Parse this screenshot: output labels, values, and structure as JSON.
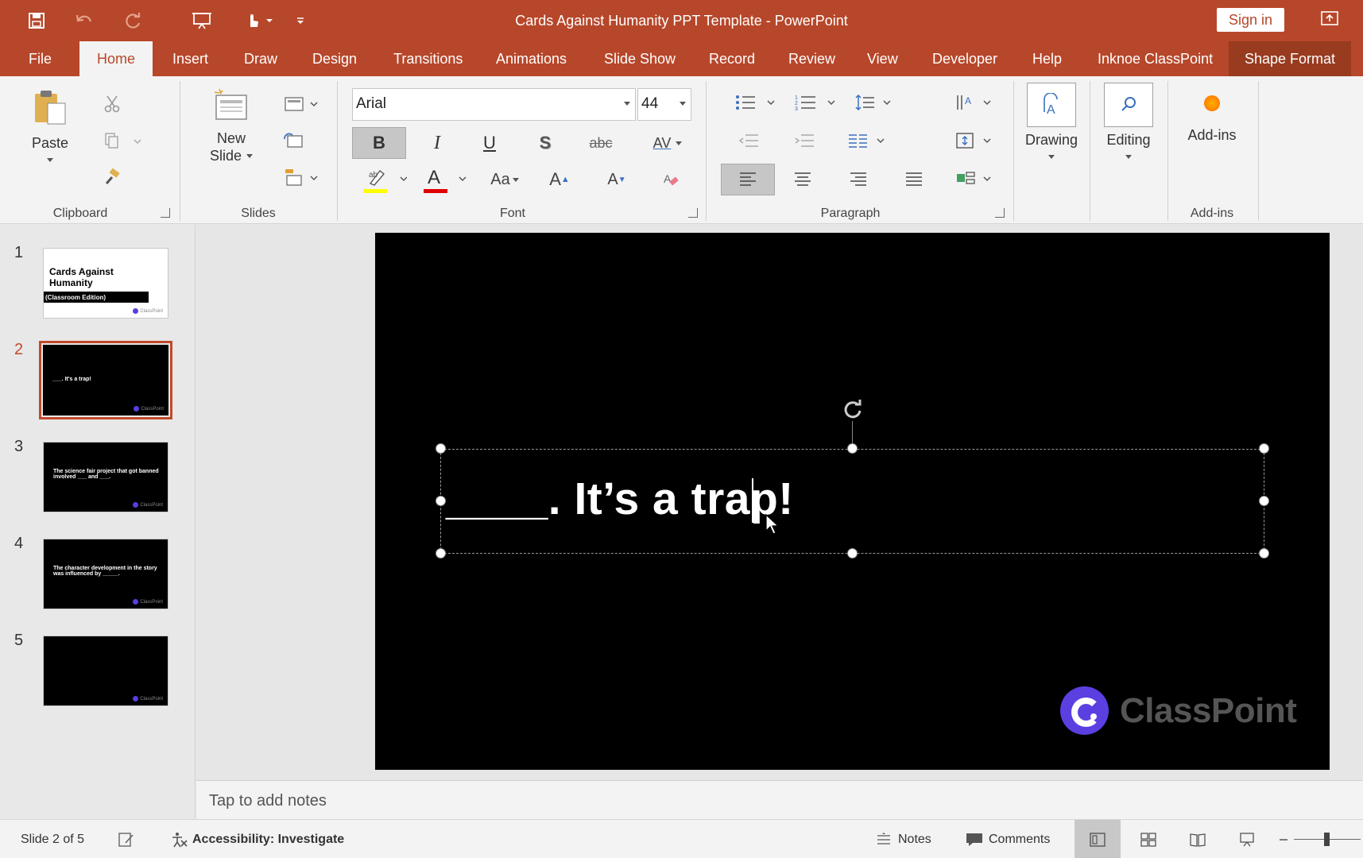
{
  "window": {
    "title": "Cards Against Humanity PPT Template  -  PowerPoint",
    "sign_in": "Sign in"
  },
  "tabs": [
    "File",
    "Home",
    "Insert",
    "Draw",
    "Design",
    "Transitions",
    "Animations",
    "Slide Show",
    "Record",
    "Review",
    "View",
    "Developer",
    "Help",
    "Inknoe ClassPoint",
    "Shape Format"
  ],
  "active_tab": "Home",
  "ribbon": {
    "clipboard": {
      "paste": "Paste",
      "label": "Clipboard"
    },
    "slides": {
      "new_slide_line1": "New",
      "new_slide_line2": "Slide",
      "label": "Slides"
    },
    "font": {
      "name": "Arial",
      "size": "44",
      "bold": "B",
      "italic": "I",
      "underline": "U",
      "shadow": "S",
      "strike": "abc",
      "spacing": "AV",
      "case": "Aa",
      "grow": "A",
      "shrink": "A",
      "label": "Font",
      "highlight_color": "#ffff00",
      "font_color": "#e00000"
    },
    "paragraph": {
      "label": "Paragraph"
    },
    "drawing": {
      "label": "Drawing"
    },
    "editing": {
      "label": "Editing"
    },
    "addins": {
      "button": "Add-ins",
      "label": "Add-ins"
    }
  },
  "thumbnails": [
    {
      "num": "1",
      "title": "Cards Against Humanity",
      "subtitle": "(Classroom Edition)"
    },
    {
      "num": "2",
      "text": "___. It's a trap!"
    },
    {
      "num": "3",
      "text": "The science fair project that got banned involved ___ and ___."
    },
    {
      "num": "4",
      "text": "The character development in the story was influenced by _____."
    },
    {
      "num": "5",
      "text": ""
    }
  ],
  "thumb_logo": "ClassPoint",
  "slide": {
    "text": "____. It’s a trap!",
    "logo": "ClassPoint",
    "background": "#000000",
    "logo_color": "#5b3fe1"
  },
  "notes_placeholder": "Tap to add notes",
  "status": {
    "slide_of": "Slide 2 of 5",
    "accessibility": "Accessibility: Investigate",
    "notes": "Notes",
    "comments": "Comments"
  },
  "colors": {
    "accent": "#b7472a",
    "shape_format_tab": "#983b1f"
  }
}
